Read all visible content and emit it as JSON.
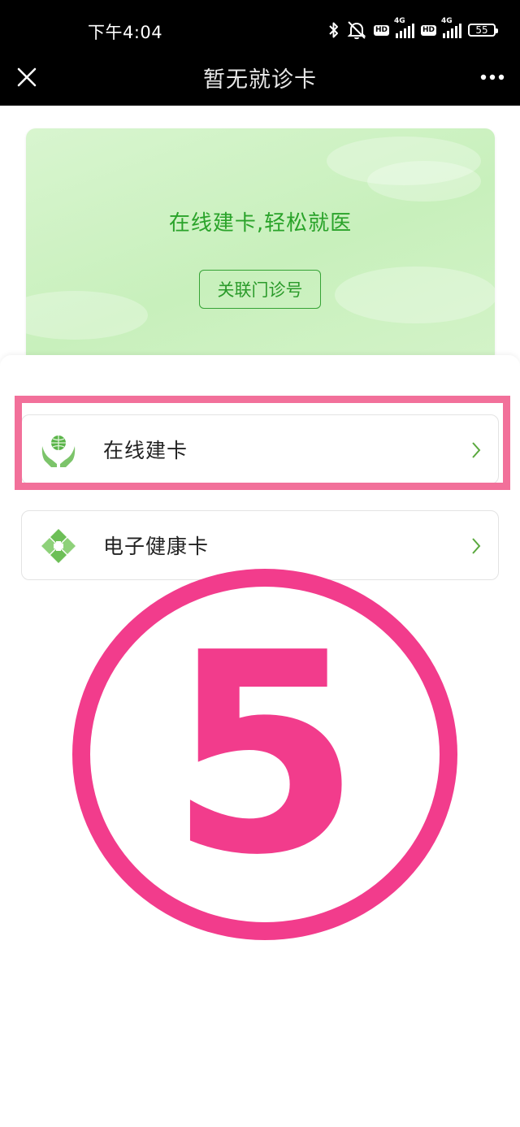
{
  "status_bar": {
    "time": "下午4:04",
    "hd_badge_1": "HD",
    "hd_badge_2": "HD",
    "network_1": "4G",
    "network_2": "4G",
    "battery": "55"
  },
  "nav": {
    "title": "暂无就诊卡",
    "close_icon": "close-icon",
    "more_icon": "more-dots-icon"
  },
  "card": {
    "slogan": "在线建卡,轻松就医",
    "button_label": "关联门诊号",
    "accent_color": "#2aa32a"
  },
  "menu": {
    "items": [
      {
        "label": "在线建卡",
        "icon": "globe-hands-icon"
      },
      {
        "label": "电子健康卡",
        "icon": "health-cross-icon"
      }
    ]
  },
  "annotation": {
    "step_number": "5",
    "color": "#f23c8c"
  }
}
